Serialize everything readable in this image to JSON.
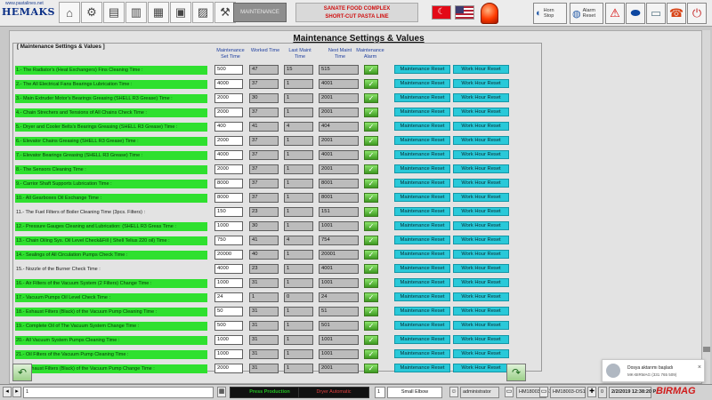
{
  "toolbar": {
    "logo_url": "www.pastalines.net",
    "logo_name": "HEMAKS",
    "maintenance_button": "MAINTENANCE",
    "company_line1": "SANATE FOOD COMPLEX",
    "company_line2": "SHORT-CUT PASTA  LINE",
    "horn_stop_line1": "Horn",
    "horn_stop_line2": "Stop",
    "alarm_reset_line1": "Alarm",
    "alarm_reset_line2": "Reset",
    "accent_red": "#d01010"
  },
  "page": {
    "title": "Maintenance Settings & Values",
    "group_label": "[ Maintenance Settings & Values ]",
    "headers": {
      "set_time": "Maintenance Set Time",
      "worked_time": "Worked Time",
      "last_maint": "Last Maint Time",
      "next_maint": "Next Maint Time",
      "alarm": "Maintenance Alarm"
    },
    "rows": [
      {
        "desc": "1.- The Radiator's (Heat Exchangers) Fins Cleaning Time :",
        "set": "500",
        "worked": "47",
        "last": "15",
        "next": "515",
        "highlight": true
      },
      {
        "desc": "2.- The All Electrical Fans Bearings Lubrication Time :",
        "set": "4000",
        "worked": "37",
        "last": "1",
        "next": "4001",
        "highlight": true
      },
      {
        "desc": "3.- Main Extruder Motor's Bearings Greasing (SHELL R3 Grease) Time :",
        "set": "2000",
        "worked": "30",
        "last": "1",
        "next": "2001",
        "highlight": true
      },
      {
        "desc": "4.- Chain Strechers and Tensions of All Chains Check Time :",
        "set": "2000",
        "worked": "37",
        "last": "1",
        "next": "2001",
        "highlight": true
      },
      {
        "desc": "5.- Dryer and Cooler Belts's Bearings Greasing (SHELL R3 Grease) Time :",
        "set": "400",
        "worked": "41",
        "last": "4",
        "next": "404",
        "highlight": true
      },
      {
        "desc": "6.- Elevator Chains Greasing (SHELL R3 Grease) Time :",
        "set": "2000",
        "worked": "37",
        "last": "1",
        "next": "2001",
        "highlight": true
      },
      {
        "desc": "7.- Elevator Bearings Greasing (SHELL R3 Grease) Time :",
        "set": "4000",
        "worked": "37",
        "last": "1",
        "next": "4001",
        "highlight": true
      },
      {
        "desc": "8.- The Sensors Cleaning Time :",
        "set": "2000",
        "worked": "37",
        "last": "1",
        "next": "2001",
        "highlight": true
      },
      {
        "desc": "9.- Carrior Shaft Supports Lubrication Time :",
        "set": "8000",
        "worked": "37",
        "last": "1",
        "next": "8001",
        "highlight": true
      },
      {
        "desc": "10.- All Gearboxes Oil Exchange Time :",
        "set": "8000",
        "worked": "37",
        "last": "1",
        "next": "8001",
        "highlight": true
      },
      {
        "desc": "11.- The Fuel Filters of Boiler Cleaning Time (3pcs. Filters) :",
        "set": "150",
        "worked": "23",
        "last": "1",
        "next": "151",
        "highlight": false
      },
      {
        "desc": "12.- Pressure Gauges Cleaning and Lubrication: (SHELL R3 Greas Time :",
        "set": "1000",
        "worked": "30",
        "last": "1",
        "next": "1001",
        "highlight": true
      },
      {
        "desc": "13.- Chain Oiling Sys. Oil Level Check&Fill ( Shell Telius 220 oil) Time :",
        "set": "750",
        "worked": "41",
        "last": "4",
        "next": "754",
        "highlight": true
      },
      {
        "desc": "14.- Sealings of All  Circulation Pumps Check Time :",
        "set": "20000",
        "worked": "40",
        "last": "1",
        "next": "20001",
        "highlight": true
      },
      {
        "desc": "15.- Nozzle of the Burner Check Time :",
        "set": "4000",
        "worked": "23",
        "last": "1",
        "next": "4001",
        "highlight": false
      },
      {
        "desc": "16.- Air Filters of the Vacuum System (2 Filters) Change Time :",
        "set": "1000",
        "worked": "31",
        "last": "1",
        "next": "1001",
        "highlight": true
      },
      {
        "desc": "17.- Vacuum Pumps Oil Level Check Time :",
        "set": "24",
        "worked": "1",
        "last": "0",
        "next": "24",
        "highlight": true
      },
      {
        "desc": "18.- Exhaust Filters (Black) of the Vacuum Pump Cleaning Time :",
        "set": "50",
        "worked": "31",
        "last": "1",
        "next": "51",
        "highlight": true
      },
      {
        "desc": "19.- Complete Oil of The Vacuum System Change Time :",
        "set": "500",
        "worked": "31",
        "last": "1",
        "next": "501",
        "highlight": true
      },
      {
        "desc": "20.- All Vacuum  System Pumps Cleaning Time :",
        "set": "1000",
        "worked": "31",
        "last": "1",
        "next": "1001",
        "highlight": true
      },
      {
        "desc": "21.- Oil Filters  of the Vacuum Pump Cleaning Time :",
        "set": "1000",
        "worked": "31",
        "last": "1",
        "next": "1001",
        "highlight": true
      },
      {
        "desc": "22.- Exhaust Filters (Black) of the Vacuum Pump Change Time :",
        "set": "2000",
        "worked": "31",
        "last": "1",
        "next": "2001",
        "highlight": true
      }
    ],
    "maint_reset_label": "Maintenance Reset",
    "work_reset_label": "Work Hour Reset"
  },
  "toast": {
    "title": "Dosya aktarımı başladı",
    "subtitle": "MK-BIRMAG (331 765 509)",
    "close": "×"
  },
  "statusbar": {
    "field1": "1",
    "press": "Press Production",
    "dryer": "Dryer Automatic",
    "count": "1",
    "product": "Small Elbow",
    "user": "administrator",
    "node1": "HM18003-OS1",
    "node2": "HM18003-OS1",
    "num": "0",
    "datetime": "2/2/2019 12:38:20 P",
    "brand": "BIRMAG"
  }
}
